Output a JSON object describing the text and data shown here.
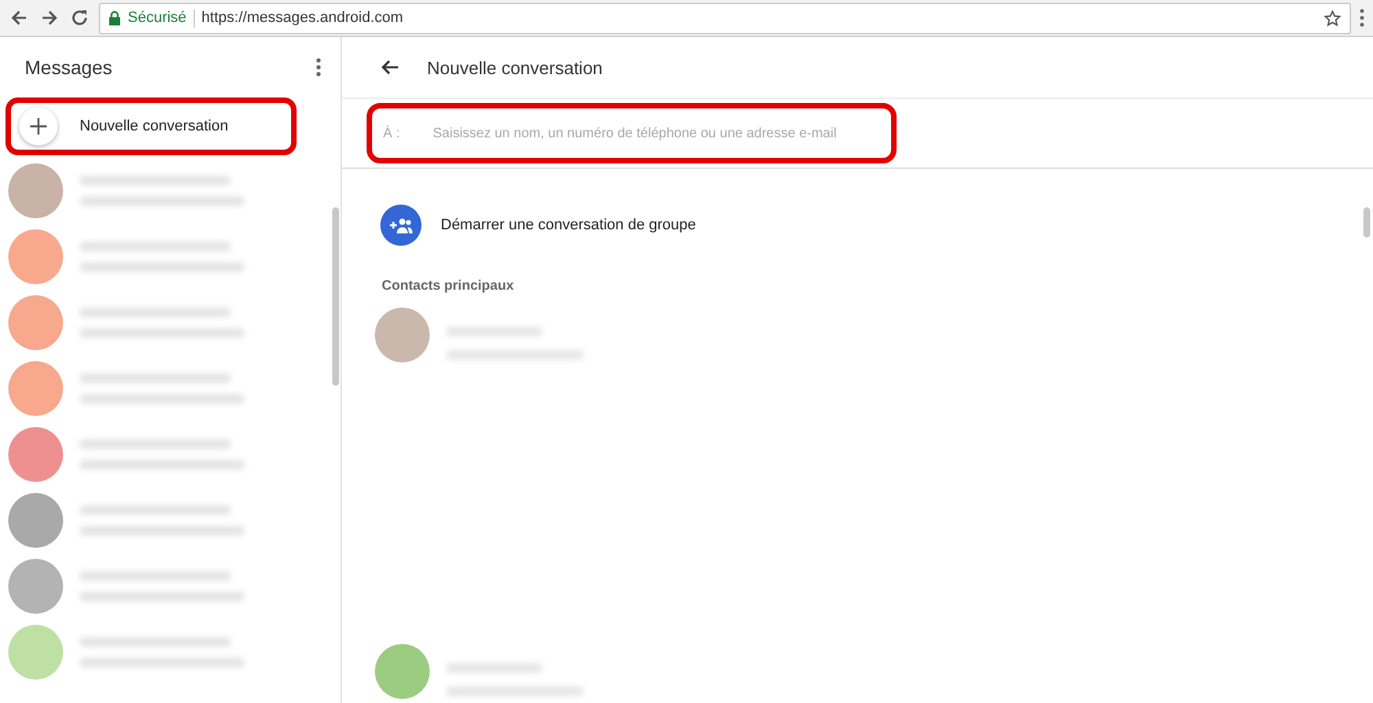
{
  "browser": {
    "security_label": "Sécurisé",
    "url": "https://messages.android.com"
  },
  "sidebar": {
    "title": "Messages",
    "new_conversation": "Nouvelle conversation",
    "conversations": [
      {
        "color": "#c9b3a6"
      },
      {
        "color": "#f8a88c"
      },
      {
        "color": "#f8a88c"
      },
      {
        "color": "#f8a88c"
      },
      {
        "color": "#ee9090"
      },
      {
        "color": "#a9a9a9"
      },
      {
        "color": "#b3b3b3"
      },
      {
        "color": "#bfe0a5"
      }
    ]
  },
  "main": {
    "title": "Nouvelle conversation",
    "to_label": "À :",
    "to_placeholder": "Saisissez un nom, un numéro de téléphone ou une adresse e-mail",
    "group_action": "Démarrer une conversation de groupe",
    "contacts_heading": "Contacts principaux",
    "contacts": [
      {
        "color": "#cbb8ac"
      },
      {
        "color": "#9ccc80"
      }
    ]
  }
}
